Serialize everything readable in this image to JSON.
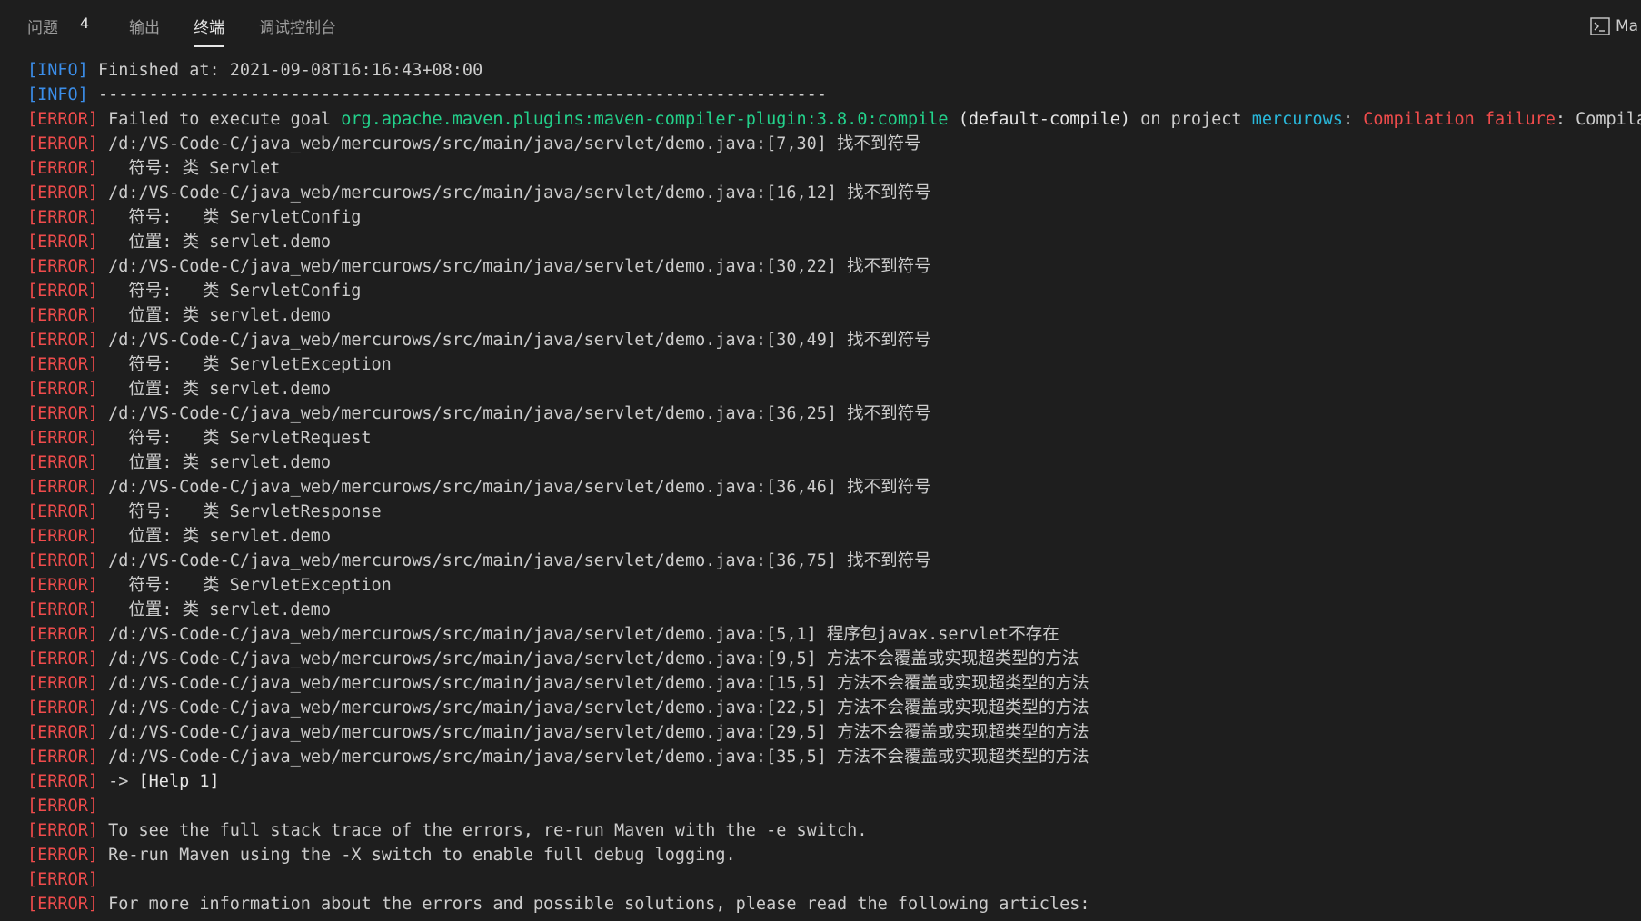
{
  "tabs": [
    {
      "label": "问题",
      "badge": "4",
      "active": false
    },
    {
      "label": "输出",
      "active": false
    },
    {
      "label": "终端",
      "active": true
    },
    {
      "label": "调试控制台",
      "active": false
    }
  ],
  "terminal_picker": {
    "label": "Ma",
    "icon": "terminal-icon"
  },
  "colors": {
    "background": "#1e1e1e",
    "info_tag": "#3b8eea",
    "error_tag": "#f14c4c",
    "goal": "#23d18b",
    "project": "#29b8db",
    "failure": "#f14c4c"
  },
  "lines": [
    {
      "tag": "[INFO]",
      "segments": [
        {
          "text": " Finished at: 2021-09-08T16:16:43+08:00"
        }
      ]
    },
    {
      "tag": "[INFO]",
      "segments": [
        {
          "text": " ------------------------------------------------------------------------"
        }
      ]
    },
    {
      "tag": "[ERROR]",
      "segments": [
        {
          "text": " Failed to execute goal "
        },
        {
          "text": "org.apache.maven.plugins:maven-compiler-plugin:3.8.0:compile",
          "style": "green"
        },
        {
          "text": " (default-compile)",
          "style": "bright"
        },
        {
          "text": " on project "
        },
        {
          "text": "mercurows",
          "style": "cyan"
        },
        {
          "text": ": "
        },
        {
          "text": "Compilation failure",
          "style": "red"
        },
        {
          "text": ": Compilation failure:"
        }
      ]
    },
    {
      "tag": "[ERROR]",
      "segments": [
        {
          "text": " /d:/VS-Code-C/java_web/mercurows/src/main/java/servlet/demo.java:[7,30] 找不到符号"
        }
      ]
    },
    {
      "tag": "[ERROR]",
      "segments": [
        {
          "text": "   符号: 类 Servlet"
        }
      ]
    },
    {
      "tag": "[ERROR]",
      "segments": [
        {
          "text": " /d:/VS-Code-C/java_web/mercurows/src/main/java/servlet/demo.java:[16,12] 找不到符号"
        }
      ]
    },
    {
      "tag": "[ERROR]",
      "segments": [
        {
          "text": "   符号:   类 ServletConfig"
        }
      ]
    },
    {
      "tag": "[ERROR]",
      "segments": [
        {
          "text": "   位置: 类 servlet.demo"
        }
      ]
    },
    {
      "tag": "[ERROR]",
      "segments": [
        {
          "text": " /d:/VS-Code-C/java_web/mercurows/src/main/java/servlet/demo.java:[30,22] 找不到符号"
        }
      ]
    },
    {
      "tag": "[ERROR]",
      "segments": [
        {
          "text": "   符号:   类 ServletConfig"
        }
      ]
    },
    {
      "tag": "[ERROR]",
      "segments": [
        {
          "text": "   位置: 类 servlet.demo"
        }
      ]
    },
    {
      "tag": "[ERROR]",
      "segments": [
        {
          "text": " /d:/VS-Code-C/java_web/mercurows/src/main/java/servlet/demo.java:[30,49] 找不到符号"
        }
      ]
    },
    {
      "tag": "[ERROR]",
      "segments": [
        {
          "text": "   符号:   类 ServletException"
        }
      ]
    },
    {
      "tag": "[ERROR]",
      "segments": [
        {
          "text": "   位置: 类 servlet.demo"
        }
      ]
    },
    {
      "tag": "[ERROR]",
      "segments": [
        {
          "text": " /d:/VS-Code-C/java_web/mercurows/src/main/java/servlet/demo.java:[36,25] 找不到符号"
        }
      ]
    },
    {
      "tag": "[ERROR]",
      "segments": [
        {
          "text": "   符号:   类 ServletRequest"
        }
      ]
    },
    {
      "tag": "[ERROR]",
      "segments": [
        {
          "text": "   位置: 类 servlet.demo"
        }
      ]
    },
    {
      "tag": "[ERROR]",
      "segments": [
        {
          "text": " /d:/VS-Code-C/java_web/mercurows/src/main/java/servlet/demo.java:[36,46] 找不到符号"
        }
      ]
    },
    {
      "tag": "[ERROR]",
      "segments": [
        {
          "text": "   符号:   类 ServletResponse"
        }
      ]
    },
    {
      "tag": "[ERROR]",
      "segments": [
        {
          "text": "   位置: 类 servlet.demo"
        }
      ]
    },
    {
      "tag": "[ERROR]",
      "segments": [
        {
          "text": " /d:/VS-Code-C/java_web/mercurows/src/main/java/servlet/demo.java:[36,75] 找不到符号"
        }
      ]
    },
    {
      "tag": "[ERROR]",
      "segments": [
        {
          "text": "   符号:   类 ServletException"
        }
      ]
    },
    {
      "tag": "[ERROR]",
      "segments": [
        {
          "text": "   位置: 类 servlet.demo"
        }
      ]
    },
    {
      "tag": "[ERROR]",
      "segments": [
        {
          "text": " /d:/VS-Code-C/java_web/mercurows/src/main/java/servlet/demo.java:[5,1] 程序包javax.servlet不存在"
        }
      ]
    },
    {
      "tag": "[ERROR]",
      "segments": [
        {
          "text": " /d:/VS-Code-C/java_web/mercurows/src/main/java/servlet/demo.java:[9,5] 方法不会覆盖或实现超类型的方法"
        }
      ]
    },
    {
      "tag": "[ERROR]",
      "segments": [
        {
          "text": " /d:/VS-Code-C/java_web/mercurows/src/main/java/servlet/demo.java:[15,5] 方法不会覆盖或实现超类型的方法"
        }
      ]
    },
    {
      "tag": "[ERROR]",
      "segments": [
        {
          "text": " /d:/VS-Code-C/java_web/mercurows/src/main/java/servlet/demo.java:[22,5] 方法不会覆盖或实现超类型的方法"
        }
      ]
    },
    {
      "tag": "[ERROR]",
      "segments": [
        {
          "text": " /d:/VS-Code-C/java_web/mercurows/src/main/java/servlet/demo.java:[29,5] 方法不会覆盖或实现超类型的方法"
        }
      ]
    },
    {
      "tag": "[ERROR]",
      "segments": [
        {
          "text": " /d:/VS-Code-C/java_web/mercurows/src/main/java/servlet/demo.java:[35,5] 方法不会覆盖或实现超类型的方法"
        }
      ]
    },
    {
      "tag": "[ERROR]",
      "segments": [
        {
          "text": " -> "
        },
        {
          "text": "[Help 1]",
          "style": "bright"
        }
      ]
    },
    {
      "tag": "[ERROR]",
      "segments": [
        {
          "text": ""
        }
      ]
    },
    {
      "tag": "[ERROR]",
      "segments": [
        {
          "text": " To see the full stack trace of the errors, re-run Maven with the -e switch."
        }
      ]
    },
    {
      "tag": "[ERROR]",
      "segments": [
        {
          "text": " Re-run Maven using the -X switch to enable full debug logging."
        }
      ]
    },
    {
      "tag": "[ERROR]",
      "segments": [
        {
          "text": ""
        }
      ]
    },
    {
      "tag": "[ERROR]",
      "segments": [
        {
          "text": " For more information about the errors and possible solutions, please read the following articles:"
        }
      ]
    }
  ]
}
